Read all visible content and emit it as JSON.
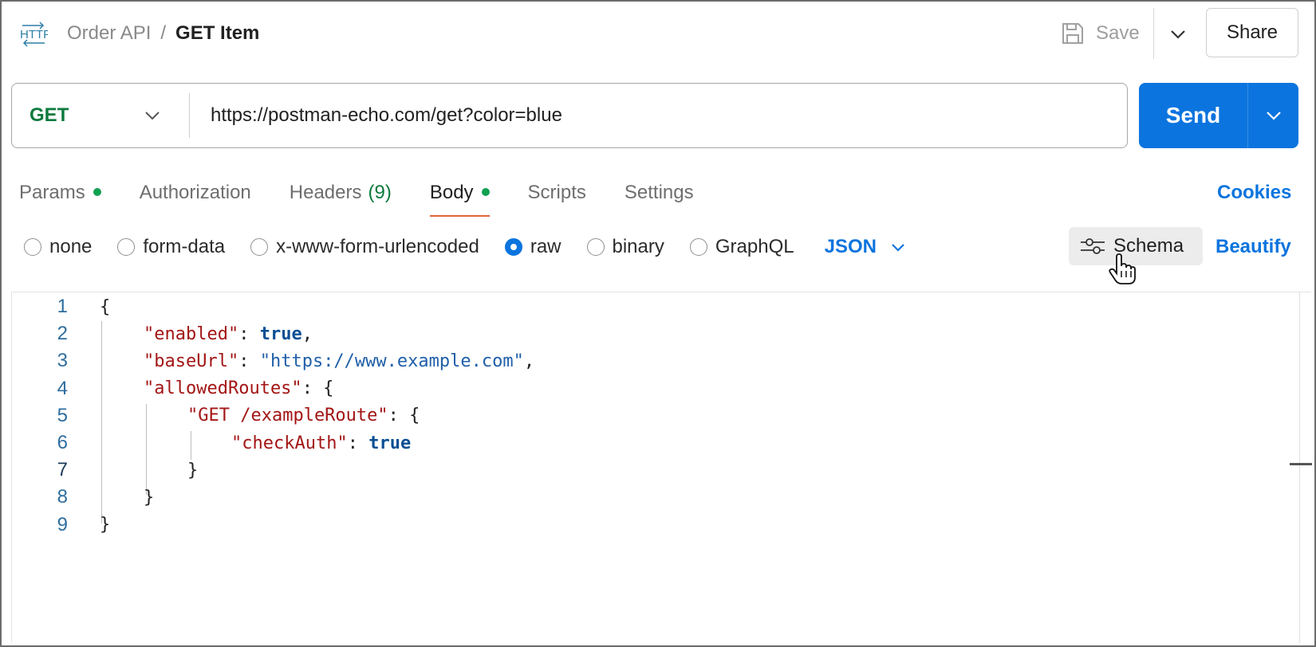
{
  "header": {
    "icon": "http-icon",
    "breadcrumb": {
      "parent": "Order API",
      "separator": "/",
      "current": "GET Item"
    },
    "save_label": "Save",
    "share_label": "Share"
  },
  "request": {
    "method": "GET",
    "url": "https://postman-echo.com/get?color=blue",
    "send_label": "Send"
  },
  "tabs": [
    {
      "label": "Params",
      "dot": true
    },
    {
      "label": "Authorization"
    },
    {
      "label": "Headers",
      "count": "(9)"
    },
    {
      "label": "Body",
      "dot": true,
      "active": true
    },
    {
      "label": "Scripts"
    },
    {
      "label": "Settings"
    }
  ],
  "cookies_label": "Cookies",
  "body_types": [
    {
      "label": "none",
      "checked": false
    },
    {
      "label": "form-data",
      "checked": false
    },
    {
      "label": "x-www-form-urlencoded",
      "checked": false
    },
    {
      "label": "raw",
      "checked": true
    },
    {
      "label": "binary",
      "checked": false
    },
    {
      "label": "GraphQL",
      "checked": false
    }
  ],
  "format_select": "JSON",
  "schema_label": "Schema",
  "beautify_label": "Beautify",
  "editor": {
    "current_line": 7,
    "lines": [
      {
        "num": "1",
        "tokens": [
          [
            "p",
            "{"
          ]
        ]
      },
      {
        "num": "2",
        "tokens": [
          [
            "k",
            "\"enabled\""
          ],
          [
            "p",
            ": "
          ],
          [
            "b",
            "true"
          ],
          [
            "p",
            ","
          ]
        ]
      },
      {
        "num": "3",
        "tokens": [
          [
            "k",
            "\"baseUrl\""
          ],
          [
            "p",
            ": "
          ],
          [
            "s",
            "\"https://www.example.com\""
          ],
          [
            "p",
            ","
          ]
        ]
      },
      {
        "num": "4",
        "tokens": [
          [
            "k",
            "\"allowedRoutes\""
          ],
          [
            "p",
            ": {"
          ]
        ]
      },
      {
        "num": "5",
        "tokens": [
          [
            "k",
            "\"GET /exampleRoute\""
          ],
          [
            "p",
            ": {"
          ]
        ]
      },
      {
        "num": "6",
        "tokens": [
          [
            "k",
            "\"checkAuth\""
          ],
          [
            "p",
            ": "
          ],
          [
            "b",
            "true"
          ]
        ]
      },
      {
        "num": "7",
        "tokens": [
          [
            "p",
            "}"
          ]
        ]
      },
      {
        "num": "8",
        "tokens": [
          [
            "p",
            "}"
          ]
        ]
      },
      {
        "num": "9",
        "tokens": [
          [
            "p",
            "}"
          ]
        ]
      }
    ]
  },
  "colors": {
    "accent": "#0b74de",
    "method_get": "#0d7a3e",
    "active_tab_underline": "#e2643b",
    "status_dot": "#12a150",
    "json_key": "#a31515",
    "json_string": "#1f5fa8",
    "json_boolean": "#0a4f94"
  }
}
